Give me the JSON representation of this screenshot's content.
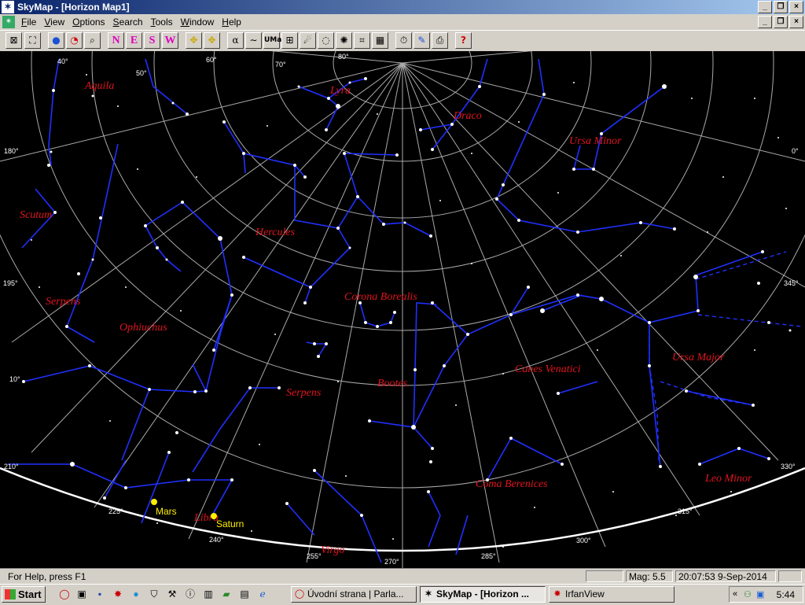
{
  "window": {
    "title": "SkyMap - [Horizon Map1]",
    "controls": [
      "_",
      "❐",
      "×"
    ]
  },
  "menu": {
    "items": [
      "File",
      "View",
      "Options",
      "Search",
      "Tools",
      "Window",
      "Help"
    ]
  },
  "toolbar": {
    "directions": [
      "N",
      "E",
      "S",
      "W"
    ],
    "buttons": [
      "zoom-fit",
      "zoom-area",
      "globe",
      "clock",
      "find",
      "stars-center",
      "stars-off",
      "alpha",
      "milky-way",
      "uma",
      "grid-toggle",
      "comet",
      "galaxy",
      "nebula",
      "constellation-lines",
      "alt-az-grid",
      "timer",
      "pen",
      "print",
      "help"
    ],
    "uma_label": "UMa",
    "alpha_label": "α"
  },
  "map": {
    "constellations": [
      "Aquila",
      "Lyra",
      "Draco",
      "Ursa Minor",
      "Scutum",
      "Hercules",
      "Serpens",
      "Corona Borealis",
      "Ophiuchus",
      "Canes Venatici",
      "Ursa Major",
      "Serpens",
      "Bootes",
      "Coma Berenices",
      "Leo Minor",
      "Libra",
      "Virgo"
    ],
    "planets": [
      "Mars",
      "Saturn"
    ],
    "altitude_labels": [
      "40°",
      "50°",
      "60°",
      "70°",
      "80°"
    ],
    "azimuth_labels": [
      "180°",
      "195°",
      "210°",
      "225°",
      "240°",
      "255°",
      "270°",
      "285°",
      "300°",
      "315°",
      "330°",
      "345°",
      "0°",
      "10°"
    ],
    "colors": {
      "constellation_lines": "#2030ff",
      "constellation_names": "#e0141e",
      "grid": "#c8c8c8",
      "horizon": "#ffffff",
      "planet": "#ffee00"
    }
  },
  "status": {
    "help": "For Help, press F1",
    "magnitude": "Mag: 5.5",
    "datetime": "20:07:53 9-Sep-2014"
  },
  "taskbar": {
    "start": "Start",
    "tasks": [
      "Úvodní strana | Parla...",
      "SkyMap - [Horizon ...",
      "IrfanView"
    ],
    "tray_time": "5:44",
    "tray_chevron": "«"
  }
}
